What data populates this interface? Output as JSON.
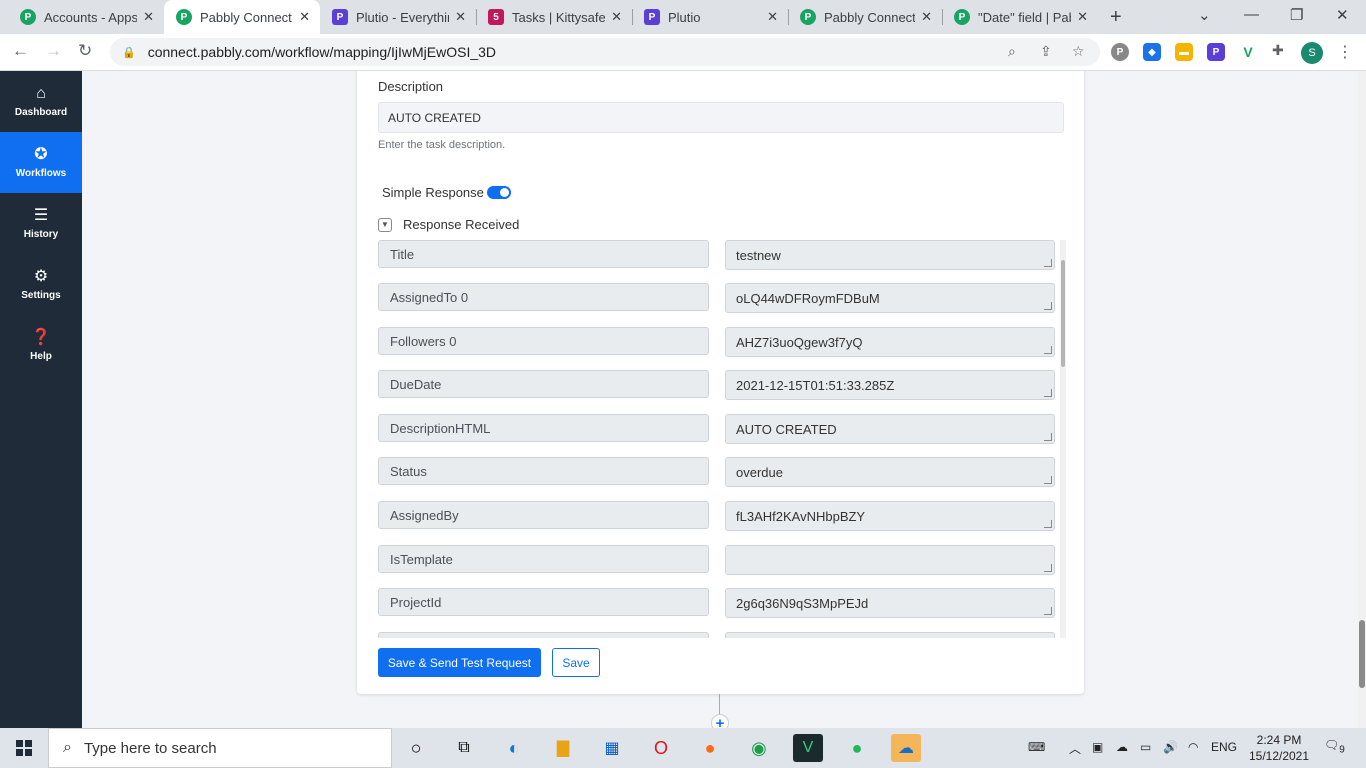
{
  "browser": {
    "tabs": [
      {
        "title": "Accounts - Apps",
        "favicon": "pabbly-icon"
      },
      {
        "title": "Pabbly Connect",
        "favicon": "pabbly-icon",
        "active": true
      },
      {
        "title": "Plutio - Everythin",
        "favicon": "plutio-icon"
      },
      {
        "title": "Tasks | Kittysafe",
        "favicon": "kittysafe-icon"
      },
      {
        "title": "Plutio",
        "favicon": "plutio-icon"
      },
      {
        "title": "Pabbly Connect",
        "favicon": "pabbly-icon"
      },
      {
        "title": "\"Date\" field | Pab",
        "favicon": "pabbly-icon"
      }
    ],
    "url": "connect.pabbly.com/workflow/mapping/IjIwMjEwOSI_3D",
    "profile_initial": "S"
  },
  "sidebar": {
    "items": [
      {
        "label": "Dashboard",
        "icon": "home-icon"
      },
      {
        "label": "Workflows",
        "icon": "workflow-icon",
        "active": true
      },
      {
        "label": "History",
        "icon": "list-icon"
      },
      {
        "label": "Settings",
        "icon": "gear-icon"
      },
      {
        "label": "Help",
        "icon": "help-icon"
      }
    ]
  },
  "form": {
    "description_label": "Description",
    "description_value": "AUTO CREATED",
    "description_hint": "Enter the task description.",
    "simple_response_label": "Simple Response",
    "simple_response_on": true,
    "response_received_label": "Response Received",
    "fields": [
      {
        "key": "Title",
        "value": "testnew"
      },
      {
        "key": "AssignedTo 0",
        "value": "oLQ44wDFRoymFDBuM"
      },
      {
        "key": "Followers 0",
        "value": "AHZ7i3uoQgew3f7yQ"
      },
      {
        "key": "DueDate",
        "value": "2021-12-15T01:51:33.285Z"
      },
      {
        "key": "DescriptionHTML",
        "value": "AUTO CREATED"
      },
      {
        "key": "Status",
        "value": "overdue"
      },
      {
        "key": "AssignedBy",
        "value": "fL3AHf2KAvNHbpBZY"
      },
      {
        "key": "IsTemplate",
        "value": ""
      },
      {
        "key": "ProjectId",
        "value": "2g6q36N9qS3MpPEJd"
      },
      {
        "key": "",
        "value": ""
      }
    ],
    "save_send_label": "Save & Send Test Request",
    "save_label": "Save"
  },
  "taskbar": {
    "search_placeholder": "Type here to search",
    "language": "ENG",
    "time": "2:24 PM",
    "date": "15/12/2021",
    "notification_count": "9"
  },
  "colors": {
    "accent": "#0f6ff0",
    "sidebar_bg": "#1f2b38",
    "pabbly_green": "#19a463"
  }
}
